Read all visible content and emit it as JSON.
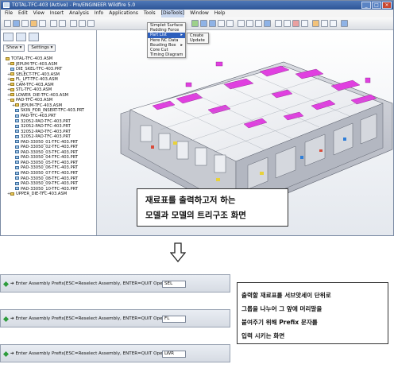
{
  "window": {
    "title": "TOTAL-TFC-403 (Active) - Pro/ENGINEER Wildfire 5.0",
    "controls": [
      "_",
      "□",
      "×"
    ]
  },
  "menubar": {
    "items": [
      "File",
      "Edit",
      "View",
      "Insert",
      "Analysis",
      "Info",
      "Applications",
      "Tools",
      "[DieTools]",
      "Window",
      "Help"
    ]
  },
  "dietools_menu": {
    "items": [
      "Simplet Surface",
      "Padding Force",
      "Part List",
      "Here NC Data",
      "Bouding Box",
      "Core Cut",
      "Timing Diagram"
    ],
    "selected": "Part List"
  },
  "partlist_submenu": {
    "items": [
      "Create",
      "Update"
    ]
  },
  "model_tree": {
    "show_label": "Show ▾",
    "settings_label": "Settings ▾",
    "items": [
      {
        "label": "TOTAL-TFC-403.ASM",
        "depth": 0,
        "type": "asm",
        "pm": ""
      },
      {
        "label": "JEPUM-TFC-403.ASM",
        "depth": 1,
        "type": "asm",
        "pm": "+"
      },
      {
        "label": "DIE_SKEL-TFC-403.PRT",
        "depth": 1,
        "type": "prt",
        "pm": ""
      },
      {
        "label": "SELECT-TFC-403.ASM",
        "depth": 1,
        "type": "asm",
        "pm": "+"
      },
      {
        "label": "FL_LFT-TFC-403.ASM",
        "depth": 1,
        "type": "asm",
        "pm": "+"
      },
      {
        "label": "CAM-TFC-403.ASM",
        "depth": 1,
        "type": "asm",
        "pm": "+"
      },
      {
        "label": "STL-TFC-403.ASM",
        "depth": 1,
        "type": "asm",
        "pm": "+"
      },
      {
        "label": "LOWER_DIE-TFC-403.ASM",
        "depth": 1,
        "type": "asm",
        "pm": "+"
      },
      {
        "label": "PAD-TFC-403.ASM",
        "depth": 1,
        "type": "asm",
        "pm": "−"
      },
      {
        "label": "JEPUM-TFC-403.ASM",
        "depth": 2,
        "type": "asm",
        "pm": "+"
      },
      {
        "label": "SKIN_FOR_INSERT-TFC-403.PRT",
        "depth": 2,
        "type": "prt",
        "pm": ""
      },
      {
        "label": "PAD-TFC-403.PRT",
        "depth": 2,
        "type": "prt",
        "pm": ""
      },
      {
        "label": "32052-PAD-TFC-403.PRT",
        "depth": 2,
        "type": "prt",
        "pm": ""
      },
      {
        "label": "32052-PAD-TFC-403.PRT",
        "depth": 2,
        "type": "prt",
        "pm": ""
      },
      {
        "label": "32052-PAD-TFC-403.PRT",
        "depth": 2,
        "type": "prt",
        "pm": ""
      },
      {
        "label": "32052-PAD-TFC-403.PRT",
        "depth": 2,
        "type": "prt",
        "pm": ""
      },
      {
        "label": "PAD-33050_01-TFC-403.PRT",
        "depth": 2,
        "type": "prt",
        "pm": ""
      },
      {
        "label": "PAD-33050_02-TFC-403.PRT",
        "depth": 2,
        "type": "prt",
        "pm": ""
      },
      {
        "label": "PAD-33050_03-TFC-403.PRT",
        "depth": 2,
        "type": "prt",
        "pm": ""
      },
      {
        "label": "PAD-33050_04-TFC-403.PRT",
        "depth": 2,
        "type": "prt",
        "pm": ""
      },
      {
        "label": "PAD-33050_05-TFC-403.PRT",
        "depth": 2,
        "type": "prt",
        "pm": ""
      },
      {
        "label": "PAD-33050_06-TFC-403.PRT",
        "depth": 2,
        "type": "prt",
        "pm": ""
      },
      {
        "label": "PAD-33050_07-TFC-403.PRT",
        "depth": 2,
        "type": "prt",
        "pm": ""
      },
      {
        "label": "PAD-33050_08-TFC-403.PRT",
        "depth": 2,
        "type": "prt",
        "pm": ""
      },
      {
        "label": "PAD-33050_09-TFC-403.PRT",
        "depth": 2,
        "type": "prt",
        "pm": ""
      },
      {
        "label": "PAD-33050_10-TFC-403.PRT",
        "depth": 2,
        "type": "prt",
        "pm": ""
      },
      {
        "label": "UPPER_DIE-TFC-403.ASM",
        "depth": 1,
        "type": "asm",
        "pm": "+"
      }
    ]
  },
  "callout": {
    "line1": "재료표를 출력하고저 하는",
    "line2": "모델과 모델의 트리구조 화면"
  },
  "prompts": [
    {
      "text": "➔ Enter Assembly Prefix[ESC=Reselect Assembly, ENTER=QUIT Operation]:",
      "value": "SEL"
    },
    {
      "text": "➔ Enter Assembly Prefix[ESC=Reselect Assembly, ENTER=QUIT Operation]:",
      "value": "FL"
    },
    {
      "text": "➔ Enter Assembly Prefix[ESC=Reselect Assembly, ENTER=QUIT Operation]:",
      "value": "LWR"
    }
  ],
  "info_box": {
    "line1": "출력할 재료표를 서브앗세이 단위로",
    "line2": "그룹을 나누어 그 앞에 머리말을",
    "line3": "붙여주기 위해 Prefix 문자를",
    "line4": "입력 시키는 화면"
  },
  "colors": {
    "titlebar": "#2d5596",
    "highlight_surface": "#e040e0",
    "menu_selection": "#2d5fbd",
    "bullet": "#2e9c3c"
  }
}
